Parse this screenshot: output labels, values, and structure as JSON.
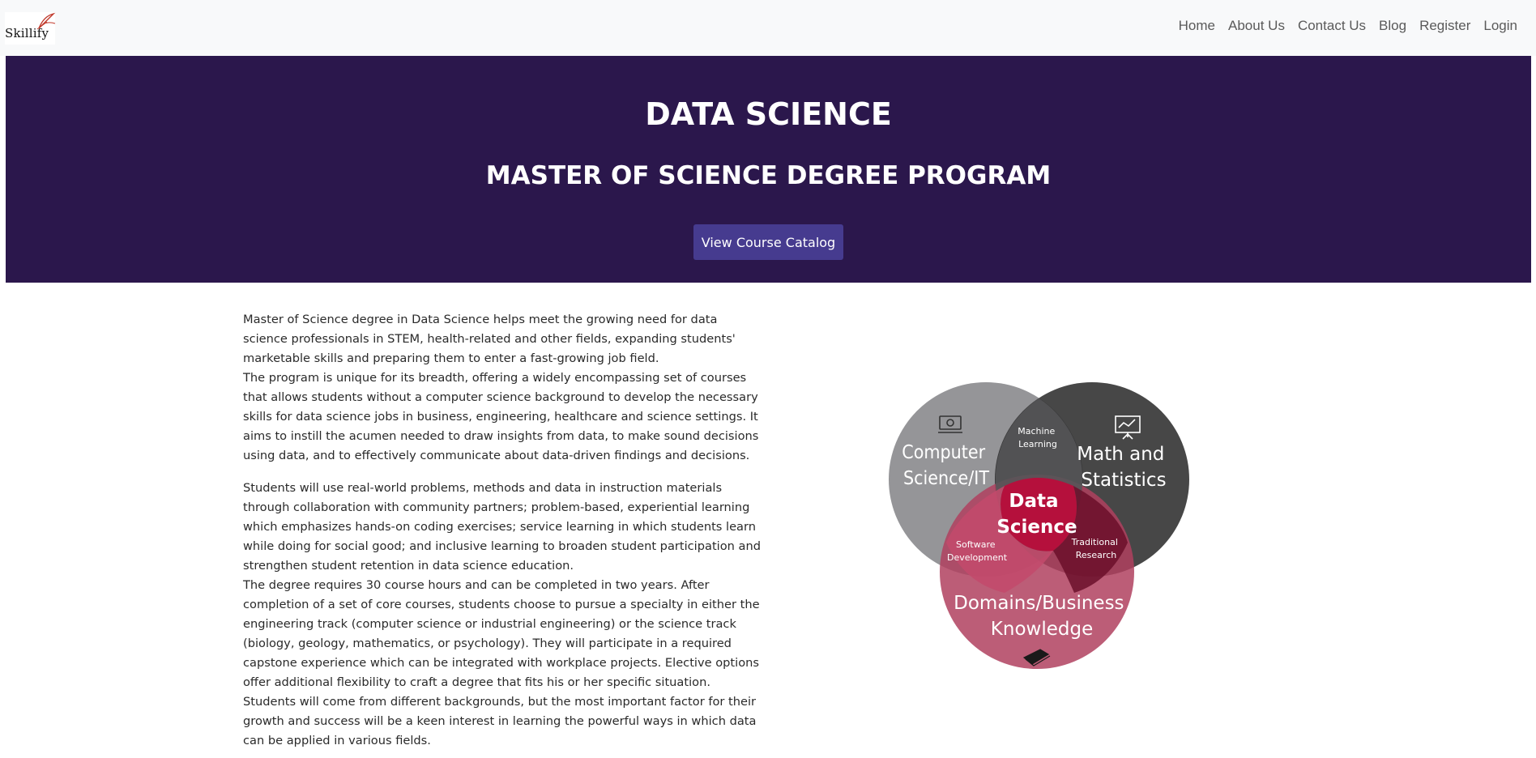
{
  "brand": {
    "name": "Skillify"
  },
  "nav": {
    "items": [
      {
        "label": "Home"
      },
      {
        "label": "About Us"
      },
      {
        "label": "Contact Us"
      },
      {
        "label": "Blog"
      },
      {
        "label": "Register"
      },
      {
        "label": "Login"
      }
    ]
  },
  "hero": {
    "title": "DATA SCIENCE",
    "subtitle": "MASTER OF SCIENCE DEGREE PROGRAM",
    "button_label": "View Course Catalog",
    "background_color": "#2b174c",
    "button_color": "#463b8f"
  },
  "content": {
    "paragraphs": [
      "Master of Science degree in Data Science helps meet the growing need for data science professionals in STEM, health-related and other fields, expanding students' marketable skills and preparing them to enter a fast-growing job field.",
      "The program is unique for its breadth, offering a widely encompassing set of courses that allows students without a computer science background to develop the necessary skills for data science jobs in business, engineering, healthcare and science settings. It aims to instill the acumen needed to draw insights from data, to make sound decisions using data, and to effectively communicate about data-driven findings and decisions.",
      "Students will use real-world problems, methods and data in instruction materials through collaboration with community partners; problem-based, experiential learning which emphasizes hands-on coding exercises; service learning in which students learn while doing for social good; and inclusive learning to broaden student participation and strengthen student retention in data science education.",
      "The degree requires 30 course hours and can be completed in two years. After completion of a set of core courses, students choose to pursue a specialty in either the engineering track (computer science or industrial engineering) or the science track (biology, geology, mathematics, or psychology). They will participate in a required capstone experience which can be integrated with workplace projects. Elective options offer additional flexibility to craft a degree that fits his or her specific situation.",
      "Students will come from different backgrounds, but the most important factor for their growth and success will be a keen interest in learning the powerful ways in which data can be applied in various fields."
    ]
  },
  "venn": {
    "circle_cs": {
      "line1": "Computer",
      "line2": "Science/IT",
      "icon": "laptop-gear-icon"
    },
    "circle_math": {
      "line1": "Math and",
      "line2": "Statistics",
      "icon": "presentation-chart-icon"
    },
    "circle_domain": {
      "line1": "Domains/Business",
      "line2": "Knowledge",
      "icon": "book-icon"
    },
    "center": {
      "line1": "Data",
      "line2": "Science"
    },
    "overlap_ml": {
      "line1": "Machine",
      "line2": "Learning"
    },
    "overlap_sd": {
      "line1": "Software",
      "line2": "Development"
    },
    "overlap_tr": {
      "line1": "Traditional",
      "line2": "Research"
    },
    "colors": {
      "cs": "#8c8c8f",
      "math": "#2e2e2e",
      "domain": "#b0415f",
      "center": "#b5103c"
    }
  }
}
